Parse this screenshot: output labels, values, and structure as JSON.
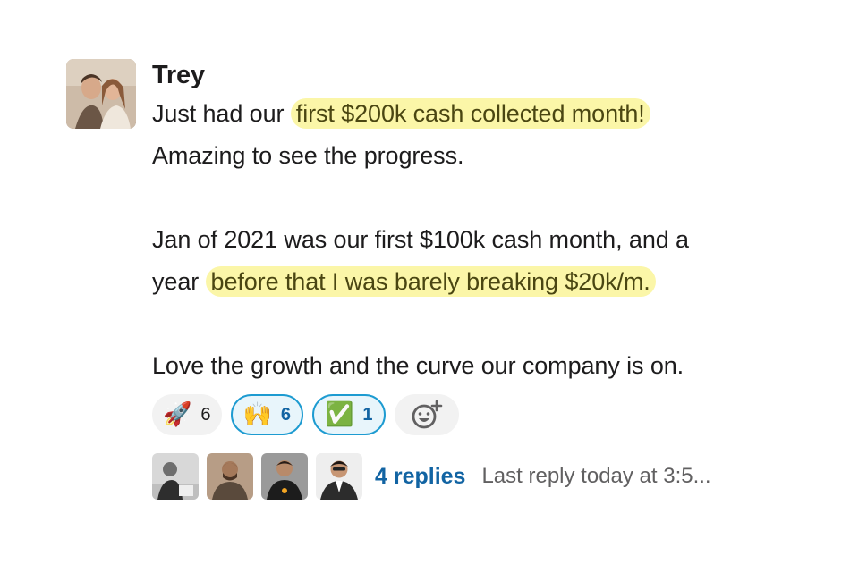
{
  "message": {
    "author": "Trey",
    "paragraphs": [
      {
        "pre": "Just had our ",
        "highlight": "first $200k cash collected month!",
        "post": ""
      },
      {
        "pre": "Amazing to see the progress.",
        "highlight": "",
        "post": ""
      },
      {
        "pre": "Jan of 2021 was our first $100k cash month, and a",
        "highlight": "",
        "post": ""
      },
      {
        "pre": "year ",
        "highlight": "before that I was barely breaking $20k/m.",
        "post": ""
      },
      {
        "pre": "Love the growth and the curve our company is on.",
        "highlight": "",
        "post": ""
      }
    ],
    "highlight_color": "#fbf6a8"
  },
  "reactions": [
    {
      "icon": "rocket-icon",
      "emoji": "🚀",
      "count": "6",
      "active": false
    },
    {
      "icon": "raised-hands-icon",
      "emoji": "🙌",
      "count": "6",
      "active": true
    },
    {
      "icon": "check-mark-icon",
      "emoji": "✅",
      "count": "1",
      "active": true
    }
  ],
  "add_reaction": {
    "icon": "add-reaction-icon"
  },
  "thread": {
    "replies_label": "4 replies",
    "last_reply": "Last reply today at 3:5..."
  },
  "colors": {
    "link": "#1264a3",
    "active_border": "#1d9bd1",
    "active_bg": "#e8f5fb"
  }
}
